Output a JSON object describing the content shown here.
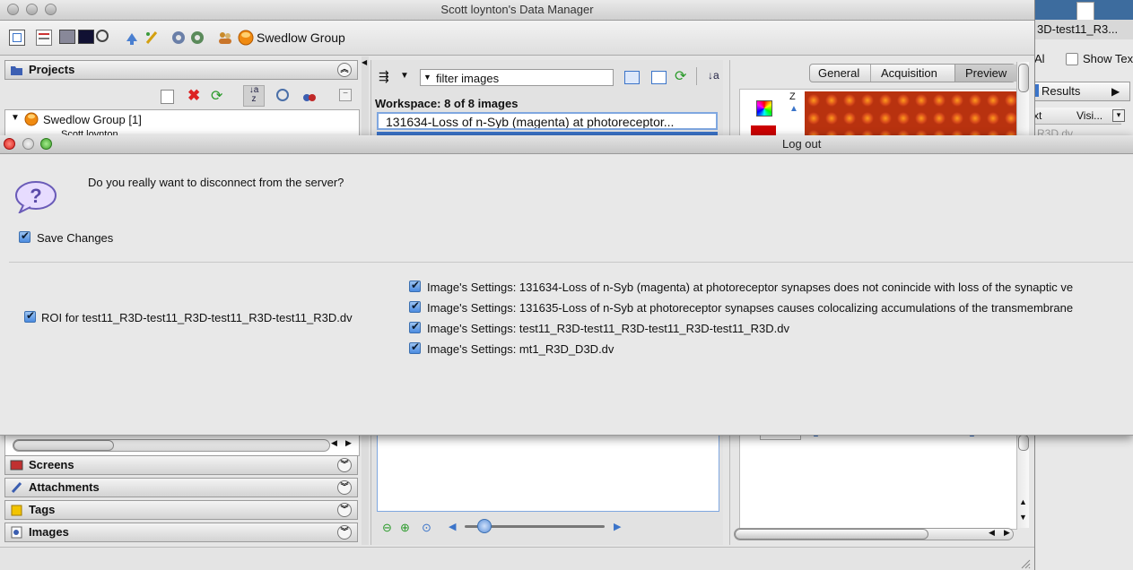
{
  "window": {
    "title": "Scott loynton's Data Manager"
  },
  "toolbar": {
    "group_label": "Swedlow Group"
  },
  "projects": {
    "header": "Projects",
    "tree_root": "Swedlow Group [1]",
    "tree_child": "Scott loynton"
  },
  "center": {
    "filter_text": "filter  images",
    "workspace_label": "Workspace: 8 of 8 images",
    "selected_item": "131634-Loss of n-Syb (magenta) at photoreceptor..."
  },
  "preview": {
    "tabs": [
      "General",
      "Acquisition",
      "Preview"
    ],
    "active_tab": "Preview",
    "z_label": "Z"
  },
  "left_panels": [
    "Screens",
    "Attachments",
    "Tags",
    "Images"
  ],
  "background_window": {
    "title_fragment": "3D-test11_R3...",
    "al_fragment": "Al",
    "show_text": "Show Tex",
    "results": "Results",
    "col1": "xt",
    "col2": "Visi...",
    "file_fragment": "R3D.dv"
  },
  "dialog": {
    "title": "Log out",
    "question": "Do you really want to disconnect from the server?",
    "save_changes": "Save Changes",
    "roi_item": "ROI for test11_R3D-test11_R3D-test11_R3D-test11_R3D.dv",
    "image_settings": [
      "Image's Settings: 131634-Loss of n-Syb (magenta) at photoreceptor synapses does not conincide with loss of the synaptic ve",
      "Image's Settings: 131635-Loss of n-Syb at photoreceptor synapses causes colocalizing accumulations of the transmembrane",
      "Image's Settings: test11_R3D-test11_R3D-test11_R3D-test11_R3D.dv",
      "Image's Settings: mt1_R3D_D3D.dv"
    ]
  },
  "colors": {
    "accent": "#3b74c9",
    "dialog_bg": "#e8e8e8"
  }
}
